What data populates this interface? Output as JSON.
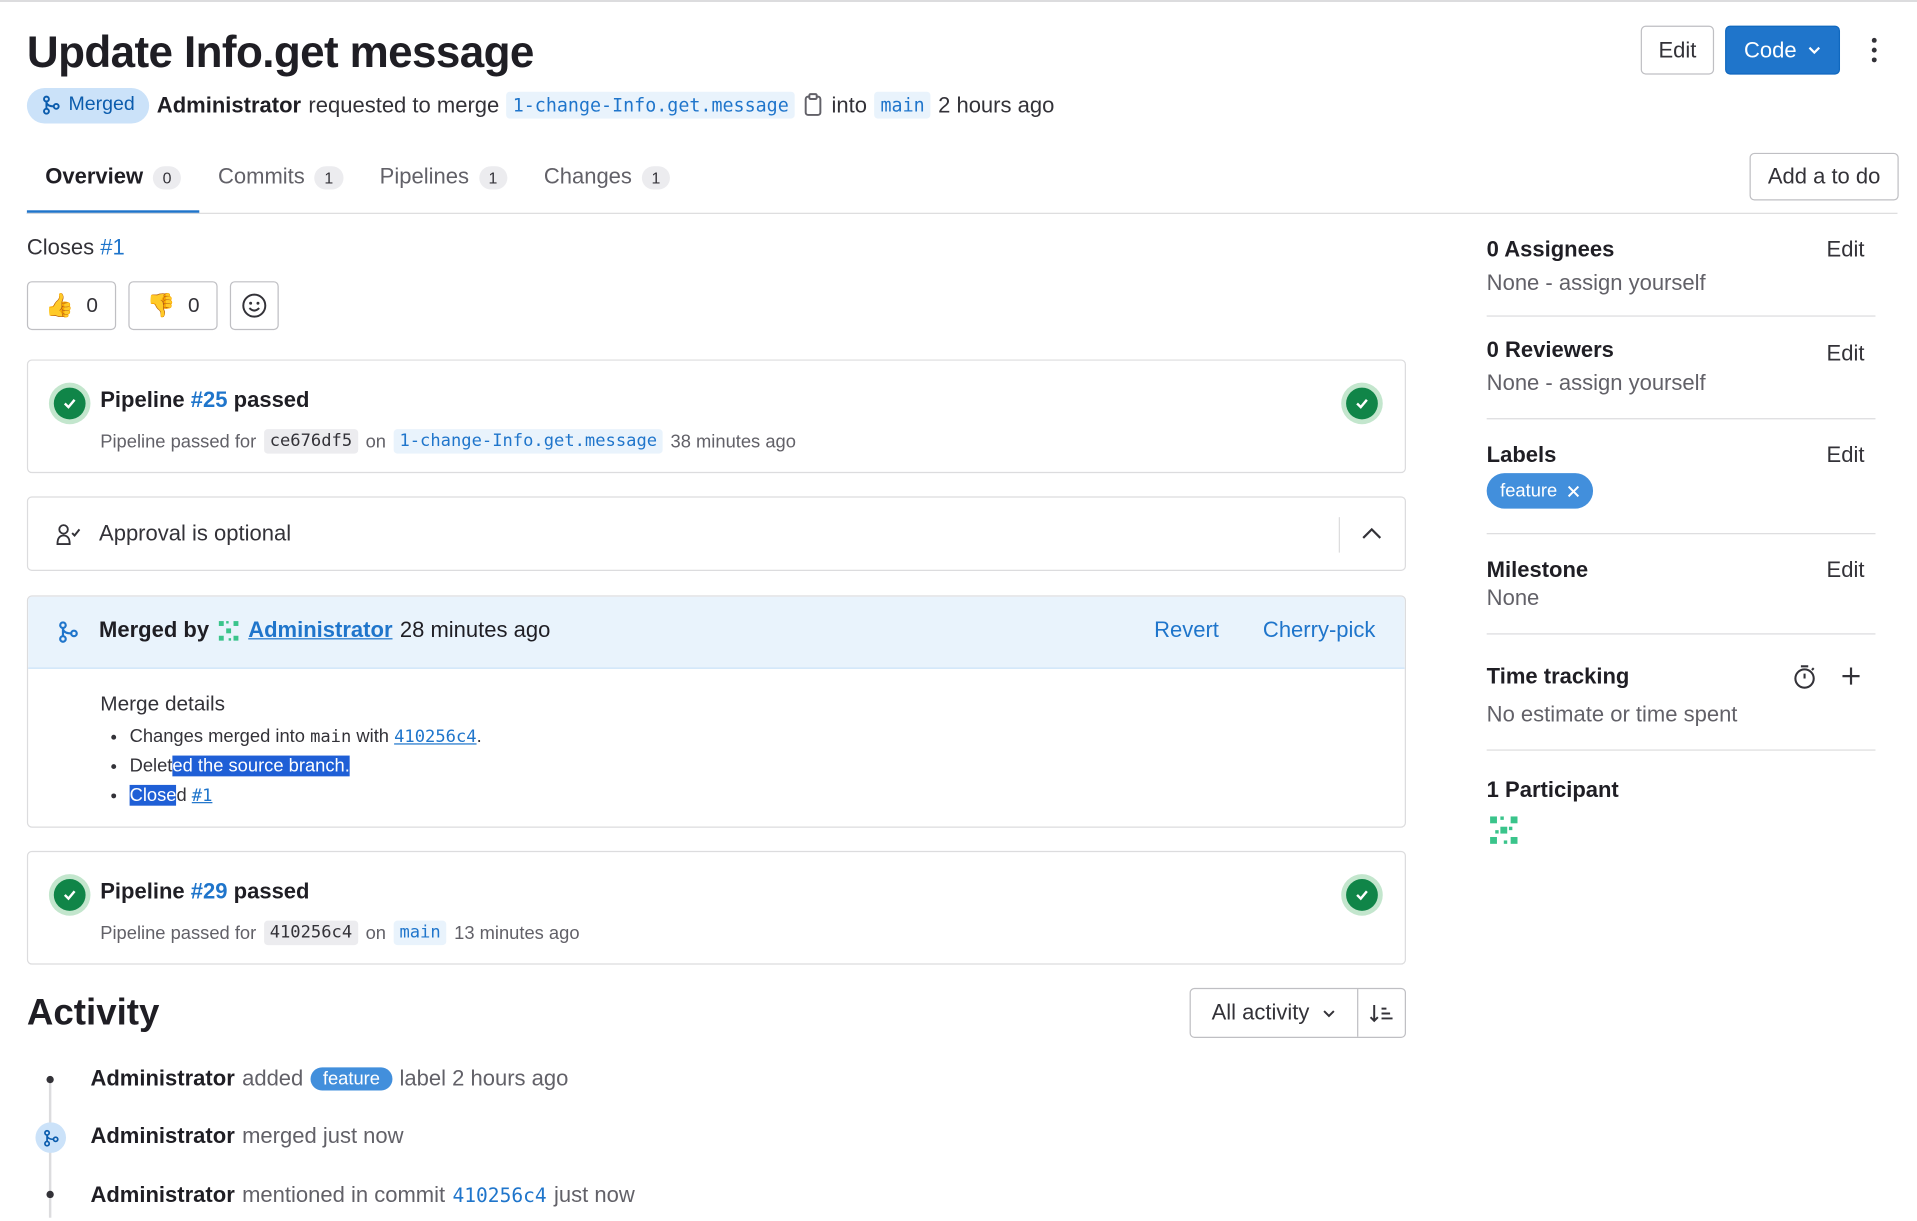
{
  "header": {
    "title": "Update Info.get message",
    "edit_label": "Edit",
    "code_label": "Code",
    "status": "Merged",
    "author": "Administrator",
    "requested_text": "requested to merge",
    "source_branch": "1-change-Info.get.message",
    "into_text": "into",
    "target_branch": "main",
    "time": "2 hours ago"
  },
  "tabs": [
    {
      "label": "Overview",
      "count": "0"
    },
    {
      "label": "Commits",
      "count": "1"
    },
    {
      "label": "Pipelines",
      "count": "1"
    },
    {
      "label": "Changes",
      "count": "1"
    }
  ],
  "todo_label": "Add a to do",
  "closes": {
    "prefix": "Closes",
    "issue": "#1"
  },
  "reactions": {
    "thumbs_up": "0",
    "thumbs_down": "0"
  },
  "pipeline1": {
    "title_prefix": "Pipeline",
    "id": "#25",
    "status": "passed",
    "sub_prefix": "Pipeline passed for",
    "commit": "ce676df5",
    "on_text": "on",
    "branch": "1-change-Info.get.message",
    "time": "38 minutes ago"
  },
  "approval": {
    "text": "Approval is optional"
  },
  "merged": {
    "prefix": "Merged by",
    "user": "Administrator",
    "time": "28 minutes ago",
    "revert": "Revert",
    "cherry_pick": "Cherry-pick",
    "details_title": "Merge details",
    "line1_a": "Changes merged into",
    "line1_branch": "main",
    "line1_b": "with",
    "line1_commit": "410256c4",
    "line1_end": ".",
    "line2_a": "Delet",
    "line2_b": "ed the source branch.",
    "line3_a": "Close",
    "line3_b": "d",
    "line3_issue": "#1"
  },
  "pipeline2": {
    "title_prefix": "Pipeline",
    "id": "#29",
    "status": "passed",
    "sub_prefix": "Pipeline passed for",
    "commit": "410256c4",
    "on_text": "on",
    "branch": "main",
    "time": "13 minutes ago"
  },
  "activity": {
    "title": "Activity",
    "filter": "All activity",
    "items": [
      {
        "user": "Administrator",
        "a": "added",
        "label": "feature",
        "b": "label 2 hours ago"
      },
      {
        "user": "Administrator",
        "a": "merged just now"
      },
      {
        "user": "Administrator",
        "a": "mentioned in commit",
        "commit": "410256c4",
        "b": "just now"
      }
    ]
  },
  "sidebar": {
    "assignees_title": "0 Assignees",
    "assignees_value": "None - assign yourself",
    "reviewers_title": "0 Reviewers",
    "reviewers_value": "None - assign yourself",
    "labels_title": "Labels",
    "label": "feature",
    "milestone_title": "Milestone",
    "milestone_value": "None",
    "time_title": "Time tracking",
    "time_value": "No estimate or time spent",
    "participants_title": "1 Participant",
    "edit_label": "Edit"
  },
  "colors": {
    "accent": "#1f75cb",
    "success": "#108548",
    "merged_bg": "#e9f3fc",
    "label": "#428fdc"
  }
}
